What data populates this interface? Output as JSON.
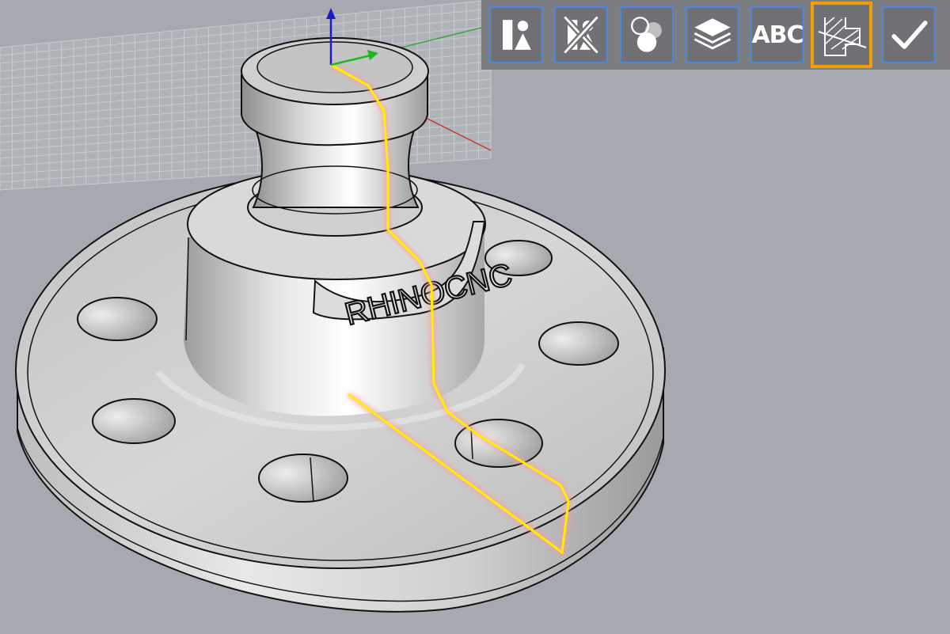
{
  "viewport": {
    "engraving_text": "RHINOCNC"
  },
  "toolbar": {
    "buttons": [
      {
        "name": "display-mode-button",
        "icon": "shapes-icon"
      },
      {
        "name": "hide-objects-button",
        "icon": "crossed-shapes-icon"
      },
      {
        "name": "render-style-button",
        "icon": "circles-icon"
      },
      {
        "name": "layers-button",
        "icon": "layers-icon"
      },
      {
        "name": "text-button",
        "icon": "abc-text-icon",
        "label": "ABC"
      },
      {
        "name": "section-button",
        "icon": "section-hatch-icon",
        "active": true
      },
      {
        "name": "confirm-button",
        "icon": "checkmark-icon"
      }
    ]
  },
  "colors": {
    "background": "#a6a9af",
    "grid": "#c9cccf",
    "section_line": "#ffee00",
    "active_border": "#f2a000",
    "button_border": "#4f88d6"
  }
}
